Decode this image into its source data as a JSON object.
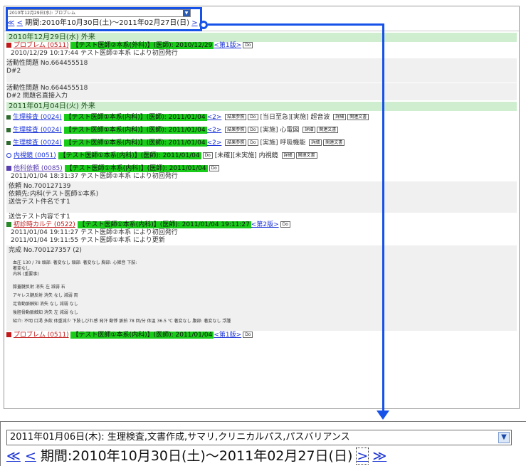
{
  "top": {
    "select_mini": "2010年12月29日(水): プロブレム",
    "nav_first": "≪",
    "nav_prev": "<",
    "period_label": "期間:2010年10月30日(土)〜2011年02月27日(日)",
    "nav_next": ">",
    "nav_last": "≫"
  },
  "day1": {
    "header": "2010年12月29日(水) 外来",
    "entry_title": "プロブレム (0511)",
    "entry_green": "【テスト医師②本系(外科)】(医師): 2010/12/29",
    "entry_version": "<第1版>",
    "do": "Do",
    "line1": "2010/12/29 10:17:44 テスト医師②本系 により初回発行",
    "prob1_a": "活動性問題 No.664455518",
    "prob1_b": "D#2",
    "prob2_a": "活動性問題 No.664455518",
    "prob2_b": "D#2 問題名直接入力"
  },
  "day2": {
    "header": "2011年01月04日(火) 外来",
    "exam1_title": "生理検査 (0024)",
    "exam1_green": "【テスト医師①本系(内科)】(医師): 2011/01/04",
    "exam1_ver": "<2>",
    "exam1_tag1": "結果参照",
    "exam1_desc": "[当日至急][実施] 超音波",
    "exam1_tag2": "詳細",
    "exam1_tag3": "関連文書",
    "exam2_title": "生理検査 (0024)",
    "exam2_green": "【テスト医師①本系(内科)】(医師): 2011/01/04",
    "exam2_ver": "<2>",
    "exam2_desc": "[実施] 心電図",
    "exam3_title": "生理検査 (0024)",
    "exam3_green": "【テスト医師①本系(内科)】(医師): 2011/01/04",
    "exam3_ver": "<2>",
    "exam3_desc": "[実施] 呼吸機能",
    "endo_title": "内視鏡 (0051)",
    "endo_green": "【テスト医師①本系(内科)】(医師): 2011/01/04",
    "endo_desc": "[未確][未実施] 内視鏡",
    "ref_title": "他科依頼 (0085)",
    "ref_green": "【テスト医師①本系(内科)】(医師): 2011/01/04",
    "ref_line1": "2011/01/04 18:31:37 テスト医師②本系 により初回発行",
    "ref_line2": "依頼 No.700127139",
    "ref_line3": "依頼先:内科(テスト医師①本系)",
    "ref_line4": "送信テスト件名です1",
    "ref_line5": "送信テスト内容です1",
    "karte_title": "初診時カルテ (0522)",
    "karte_green": "【テスト医師①本系(内科)】(医師): 2011/01/04 19:11:27",
    "karte_ver": "<第2版>",
    "karte_line1": "2011/01/04 19:11:27 テスト医師②本系 により初回発行",
    "karte_line2": "2011/01/04 19:11:55 テスト医師①本系 により更新",
    "karte_line3": "完成 No.700127357 (2)",
    "vit_line1": "血圧 130 / 78 頭部: 著変なし 頸部: 著変なし 胸部: 心雑音 下肢:",
    "vit_line2": "著変なし",
    "vit_line3": "内科 (重要事)",
    "ref_a": "膝蓋腱反射 消失 左 減弱 右",
    "ref_b": "アキレス腱反射 消失 なし 減弱 両",
    "ref_c": "足背動脈触知 消失 なし 減弱 なし",
    "ref_d": "後脛骨動脈触知 消失 左 減弱 なし",
    "ref_e": "紹介: 不明 口渇 多飲 体重減少 下肢しびれ感 発汗 動悸 脈拍 78 回/分 体温 36.5 ℃ 著変なし 腹部: 著変なし 浮腫",
    "last_title": "プロブレム (0511)",
    "last_green": "【テスト医師①本系(内科)】(医師): 2011/01/04",
    "last_ver": "<第1版>"
  },
  "zoom": {
    "select_value": "2011年01月06日(木): 生理検査,文書作成,サマリ,クリニカルパス,パスバリアンス",
    "nav_first": "≪",
    "nav_prev": "<",
    "period_label": "期間:2010年10月30日(土)〜2011年02月27日(日)",
    "nav_next": ">",
    "nav_last": "≫"
  },
  "colors": {
    "accent": "#1652e8",
    "highlight_green": "#1acc1a",
    "day_header": "#cfeecf",
    "title_red": "#c01a1a",
    "link": "#1c34d6"
  }
}
